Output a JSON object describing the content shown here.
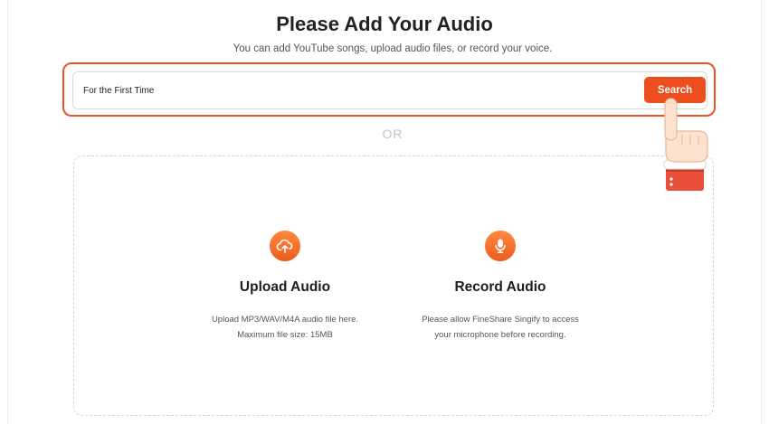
{
  "header": {
    "title": "Please Add Your Audio",
    "subtitle": "You can add YouTube songs, upload audio files, or record your voice."
  },
  "search": {
    "value": "For the First Time",
    "button_label": "Search"
  },
  "divider": {
    "label": "OR"
  },
  "options": {
    "upload": {
      "icon": "cloud-upload-icon",
      "title": "Upload Audio",
      "desc_line1": "Upload MP3/WAV/M4A audio file here.",
      "desc_line2": "Maximum file size: 15MB"
    },
    "record": {
      "icon": "microphone-icon",
      "title": "Record Audio",
      "desc_line1": "Please allow FineShare Singify to access",
      "desc_line2": "your microphone before recording."
    }
  },
  "colors": {
    "accent": "#ec4e20",
    "highlight_border": "#e8542a"
  }
}
